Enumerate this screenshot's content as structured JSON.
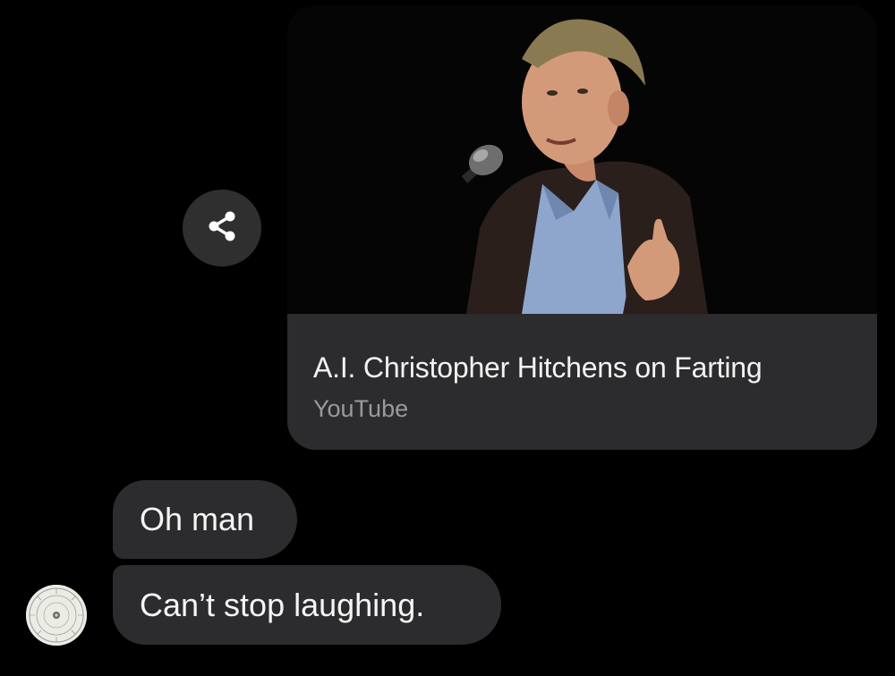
{
  "link_preview": {
    "title": "A.I. Christopher Hitchens on Farting",
    "source": "YouTube",
    "thumbnail_icon": "speaker-photo"
  },
  "share_button": {
    "icon": "share-icon"
  },
  "messages": [
    {
      "text": "Oh man"
    },
    {
      "text": "Can’t stop laughing."
    }
  ],
  "avatar": {
    "icon": "slide-rule-dial-avatar"
  },
  "colors": {
    "background": "#000000",
    "bubble": "#2c2c2e",
    "text_primary": "#f5f5f5",
    "text_secondary": "#9a9a9c"
  }
}
